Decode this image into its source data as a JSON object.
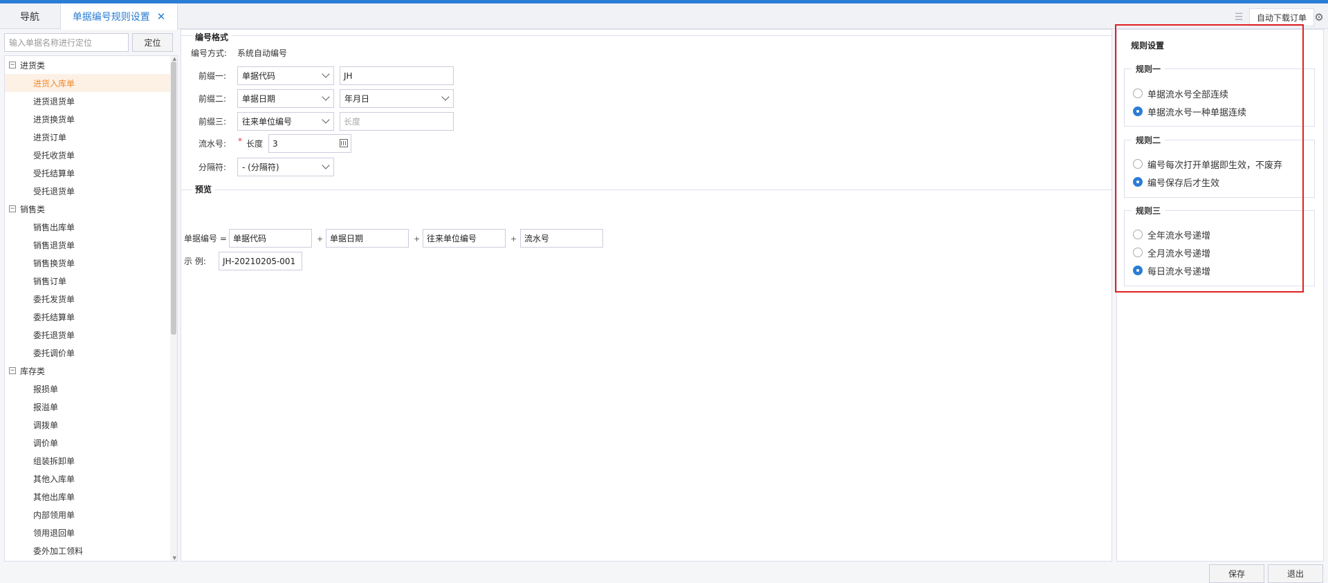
{
  "tabs": {
    "nav": "导航",
    "active": "单据编号规则设置",
    "close": "✕"
  },
  "toolbar": {
    "auto_download": "自动下载订单",
    "list_icon": "list-icon",
    "gear_icon": "gear-icon"
  },
  "sidebar": {
    "search_placeholder": "输入单据名称进行定位",
    "locate_label": "定位",
    "categories": [
      {
        "label": "进货类",
        "items": [
          "进货入库单",
          "进货退货单",
          "进货换货单",
          "进货订单",
          "受托收货单",
          "受托结算单",
          "受托退货单"
        ]
      },
      {
        "label": "销售类",
        "items": [
          "销售出库单",
          "销售退货单",
          "销售换货单",
          "销售订单",
          "委托发货单",
          "委托结算单",
          "委托退货单",
          "委托调价单"
        ]
      },
      {
        "label": "库存类",
        "items": [
          "报损单",
          "报溢单",
          "调拨单",
          "调价单",
          "组装拆卸单",
          "其他入库单",
          "其他出库单",
          "内部领用单",
          "领用退回单",
          "委外加工领料"
        ]
      }
    ],
    "active_item": "进货入库单"
  },
  "format": {
    "legend": "编号格式",
    "method_label": "编号方式:",
    "method_value": "系统自动编号",
    "prefix1_label": "前缀一:",
    "prefix1_select": "单据代码",
    "prefix1_input": "JH",
    "prefix2_label": "前缀二:",
    "prefix2_select": "单据日期",
    "prefix2_select2": "年月日",
    "prefix3_label": "前缀三:",
    "prefix3_select": "往来单位编号",
    "prefix3_placeholder": "长度",
    "serial_label": "流水号:",
    "serial_required": "*",
    "serial_length_label": "长度",
    "serial_length_value": "3",
    "separator_label": "分隔符:",
    "separator_select": "- (分隔符)"
  },
  "preview": {
    "legend": "预览",
    "number_label": "单据编号 =",
    "parts": [
      "单据代码",
      "单据日期",
      "往来单位编号",
      "流水号"
    ],
    "plus": "+",
    "example_label": "示  例:",
    "example_value": "JH-20210205-001"
  },
  "rules": {
    "title": "规则设置",
    "groups": [
      {
        "legend": "规则一",
        "options": [
          {
            "label": "单据流水号全部连续",
            "checked": false
          },
          {
            "label": "单据流水号一种单据连续",
            "checked": true
          }
        ]
      },
      {
        "legend": "规则二",
        "options": [
          {
            "label": "编号每次打开单据即生效，不废弃",
            "checked": false
          },
          {
            "label": "编号保存后才生效",
            "checked": true
          }
        ]
      },
      {
        "legend": "规则三",
        "options": [
          {
            "label": "全年流水号递增",
            "checked": false
          },
          {
            "label": "全月流水号递增",
            "checked": false
          },
          {
            "label": "每日流水号递增",
            "checked": true
          }
        ]
      }
    ]
  },
  "footer": {
    "save": "保存",
    "exit": "退出"
  },
  "colors": {
    "accent": "#2a7dd4",
    "active_item": "#f08a2d",
    "highlight": "#e02020"
  }
}
